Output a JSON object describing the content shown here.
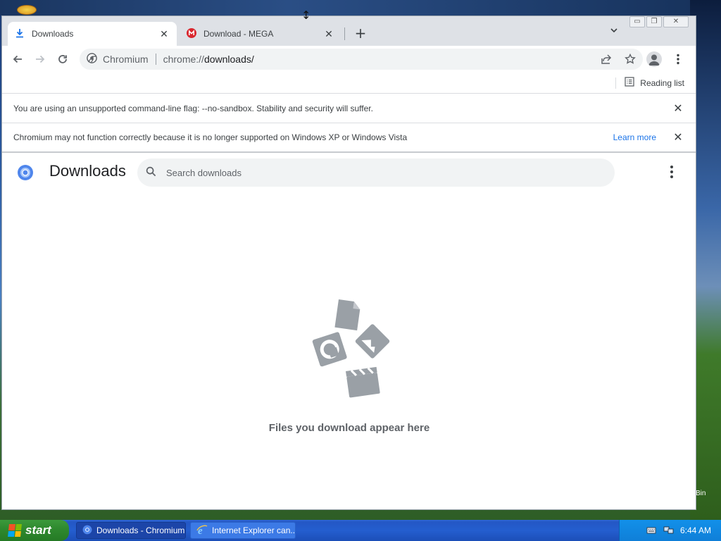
{
  "browser": {
    "tabs": [
      {
        "title": "Downloads",
        "icon": "download-icon",
        "active": true
      },
      {
        "title": "Download - MEGA",
        "icon": "mega-icon",
        "active": false
      }
    ],
    "omnibox": {
      "site_label": "Chromium",
      "url_prefix": "chrome://",
      "url_host": "downloads/"
    },
    "reading_list": "Reading list",
    "infobars": [
      {
        "message": "You are using an unsupported command-line flag: --no-sandbox. Stability and security will suffer."
      },
      {
        "message": "Chromium may not function correctly because it is no longer supported on Windows XP or Windows Vista",
        "link": "Learn more"
      }
    ]
  },
  "downloads_page": {
    "title": "Downloads",
    "search_placeholder": "Search downloads",
    "empty_message": "Files you download appear here"
  },
  "desktop": {
    "recycle_bin_partial_label": "Bin"
  },
  "taskbar": {
    "start_label": "start",
    "tasks": [
      {
        "label": "Downloads - Chromium",
        "icon": "chromium-icon",
        "active": true
      },
      {
        "label": "Internet Explorer can...",
        "icon": "ie-icon",
        "active": false
      }
    ],
    "clock": "6:44 AM"
  },
  "colors": {
    "accent_blue": "#1a73e8",
    "mega_red": "#d9272e",
    "taskbar_blue": "#245ecf",
    "start_green": "#2f8a2f"
  }
}
